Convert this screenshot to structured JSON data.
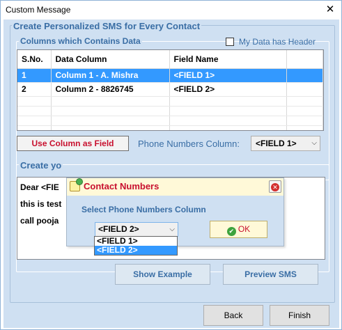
{
  "window": {
    "title": "Custom Message"
  },
  "main": {
    "heading": "Create Personalized SMS for Every Contact",
    "columns_legend": "Columns which Contains Data",
    "header_checkbox_label": "My Data has Header",
    "header_checkbox_checked": false,
    "table": {
      "headers": [
        "S.No.",
        "Data Column",
        "Field Name"
      ],
      "rows": [
        {
          "sno": "1",
          "data": "Column 1 - A. Mishra",
          "field": "<FIELD 1>"
        },
        {
          "sno": "2",
          "data": "Column 2 - 8826745",
          "field": "<FIELD 2>"
        }
      ],
      "selected_row": 0
    },
    "use_column_button": "Use Column as Field",
    "phone_label": "Phone Numbers Column:",
    "phone_value": "<FIELD 1>",
    "message_legend": "Create yo",
    "message_lines": [
      "Dear <FIE",
      "this is test",
      "call pooja"
    ],
    "show_example": "Show Example",
    "preview_sms": "Preview SMS"
  },
  "footer": {
    "back": "Back",
    "finish": "Finish"
  },
  "popup": {
    "title": "Contact Numbers",
    "label": "Select Phone Numbers Column",
    "selected": "<FIELD 2>",
    "options": [
      "<FIELD 1>",
      "<FIELD 2>"
    ],
    "ok": "OK"
  },
  "colors": {
    "accent": "#3a6ea5",
    "red": "#c8102e",
    "client_bg": "#cfe0f2",
    "selection": "#3399ff"
  }
}
